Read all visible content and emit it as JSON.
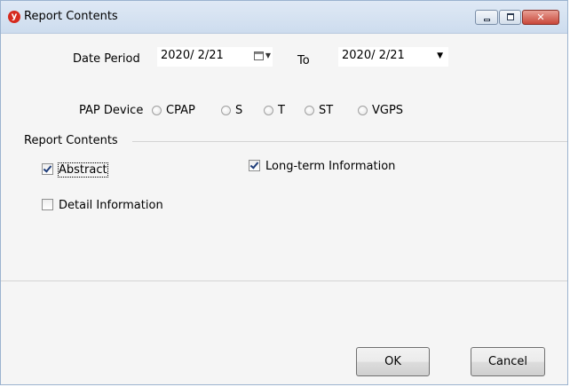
{
  "window": {
    "title": "Report Contents",
    "icon": "app-logo-icon",
    "icon_glyph": "y",
    "controls": {
      "minimize": "minimize-icon",
      "maximize": "maximize-icon",
      "close": "close-icon",
      "close_glyph": "✕"
    }
  },
  "date_period": {
    "label": "Date Period",
    "from_value": "2020/  2/21",
    "to_label": "To",
    "to_value": "2020/  2/21",
    "to_arrow": "▼",
    "cal_arrow": "▼"
  },
  "pap_device": {
    "label": "PAP Device",
    "options": [
      "CPAP",
      "S",
      "T",
      "ST",
      "VGPS"
    ]
  },
  "report_contents": {
    "title": "Report Contents",
    "checkboxes": {
      "abstract": {
        "label": "Abstract",
        "checked": true
      },
      "long_term": {
        "label": "Long-term Information",
        "checked": true
      },
      "detail": {
        "label": "Detail Information",
        "checked": false
      }
    }
  },
  "buttons": {
    "ok": "OK",
    "cancel": "Cancel"
  },
  "colors": {
    "titlebar": "#dfe9f5",
    "close_button": "#c9473a",
    "app_icon": "#d62a1e",
    "check_mark": "#1f3d7a"
  }
}
